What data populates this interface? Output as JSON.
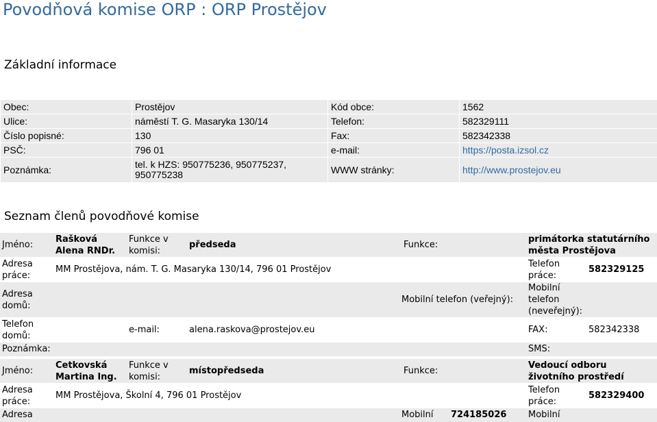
{
  "page_title": "Povodňová komise ORP : ORP Prostějov",
  "info_heading": "Základní informace",
  "info": {
    "obec_label": "Obec:",
    "obec": "Prostějov",
    "kod_label": "Kód obce:",
    "kod": "1562",
    "ulice_label": "Ulice:",
    "ulice": "náměstí T. G. Masaryka 130/14",
    "telefon_label": "Telefon:",
    "telefon": "582329111",
    "cislo_label": "Číslo popisné:",
    "cislo": "130",
    "fax_label": "Fax:",
    "fax": "582342338",
    "psc_label": "PSČ:",
    "psc": "796 01",
    "email_label": "e-mail:",
    "email": "https://posta.izsol.cz",
    "poznamka_label": "Poznámka:",
    "poznamka": "tel. k HZS: 950775236, 950775237, 950775238",
    "www_label": "WWW stránky:",
    "www": "http://www.prostejov.eu"
  },
  "members_heading": "Seznam členů povodňové komise",
  "labels": {
    "jmeno": "Jméno:",
    "funkce_v_komisi": "Funkce v komisi:",
    "funkce": "Funkce:",
    "adresa_prace": "Adresa práce:",
    "telefon_prace": "Telefon práce:",
    "adresa_domu": "Adresa domů:",
    "mobil_verejny": "Mobilní telefon (veřejný):",
    "mobil_neverejny": "Mobilní telefon (neveřejný):",
    "telefon_domu": "Telefon domů:",
    "email": "e-mail:",
    "fax": "FAX:",
    "poznamka": "Poznámka:",
    "sms": "SMS:",
    "adresa": "Adresa",
    "mobilni": "Mobilní"
  },
  "members": [
    {
      "name": "Rašková Alena RNDr.",
      "committee_role": "předseda",
      "function": "primátorka statutárního města Prostějova",
      "work_address": "MM Prostějova, nám. T. G. Masaryka 130/14, 796 01 Prostějov",
      "work_phone": "582329125",
      "email": "alena.raskova@prostejov.eu",
      "fax": "582342338"
    },
    {
      "name": "Cetkovská Martina Ing.",
      "committee_role": "místopředseda",
      "function": "Vedoucí odboru životního prostředí",
      "work_address": "MM Prostějova, Školní 4, 796 01 Prostějov",
      "work_phone": "582329400",
      "mobile_public": "724185026"
    }
  ]
}
